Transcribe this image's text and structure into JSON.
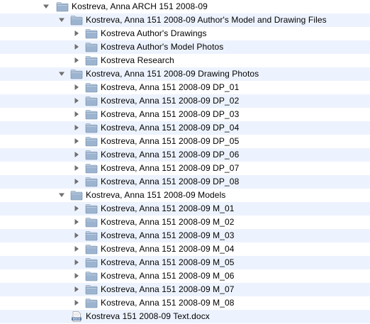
{
  "colors": {
    "row_alternate": "#edf3fe",
    "folder_body": "#9cb4cf",
    "folder_tab": "#b7c9dd",
    "disclosure": "#6f6f6f"
  },
  "tree": {
    "root": {
      "label": "Kostreva, Anna ARCH 151 2008-09",
      "icon": "folder-icon",
      "expanded": true
    },
    "authors_group": {
      "label": "Kostreva, Anna 151 2008-09 Author's Model and Drawing Files",
      "icon": "folder-icon",
      "expanded": true,
      "children": [
        {
          "label": "Kostreva Author's Drawings",
          "icon": "folder-icon",
          "expanded": false
        },
        {
          "label": "Kostreva Author's Model Photos",
          "icon": "folder-icon",
          "expanded": false
        },
        {
          "label": "Kostreva Research",
          "icon": "folder-icon",
          "expanded": false
        }
      ]
    },
    "drawing_photos_group": {
      "label": "Kostreva, Anna 151 2008-09 Drawing Photos",
      "icon": "folder-icon",
      "expanded": true,
      "children": [
        {
          "label": "Kostreva, Anna 151 2008-09 DP_01",
          "icon": "folder-icon",
          "expanded": false
        },
        {
          "label": "Kostreva, Anna 151 2008-09 DP_02",
          "icon": "folder-icon",
          "expanded": false
        },
        {
          "label": "Kostreva, Anna 151 2008-09 DP_03",
          "icon": "folder-icon",
          "expanded": false
        },
        {
          "label": "Kostreva, Anna 151 2008-09 DP_04",
          "icon": "folder-icon",
          "expanded": false
        },
        {
          "label": "Kostreva, Anna 151 2008-09 DP_05",
          "icon": "folder-icon",
          "expanded": false
        },
        {
          "label": "Kostreva, Anna 151 2008-09 DP_06",
          "icon": "folder-icon",
          "expanded": false
        },
        {
          "label": "Kostreva, Anna 151 2008-09 DP_07",
          "icon": "folder-icon",
          "expanded": false
        },
        {
          "label": "Kostreva, Anna 151 2008-09 DP_08",
          "icon": "folder-icon",
          "expanded": false
        }
      ]
    },
    "models_group": {
      "label": "Kostreva, Anna 151 2008-09 Models",
      "icon": "folder-icon",
      "expanded": true,
      "children": [
        {
          "label": "Kostreva, Anna 151 2008-09 M_01",
          "icon": "folder-icon",
          "expanded": false
        },
        {
          "label": "Kostreva, Anna 151 2008-09 M_02",
          "icon": "folder-icon",
          "expanded": false
        },
        {
          "label": "Kostreva, Anna 151 2008-09 M_03",
          "icon": "folder-icon",
          "expanded": false
        },
        {
          "label": "Kostreva, Anna 151 2008-09 M_04",
          "icon": "folder-icon",
          "expanded": false
        },
        {
          "label": "Kostreva, Anna 151 2008-09 M_05",
          "icon": "folder-icon",
          "expanded": false
        },
        {
          "label": "Kostreva, Anna 151 2008-09 M_06",
          "icon": "folder-icon",
          "expanded": false
        },
        {
          "label": "Kostreva, Anna 151 2008-09 M_07",
          "icon": "folder-icon",
          "expanded": false
        },
        {
          "label": "Kostreva, Anna 151 2008-09 M_08",
          "icon": "folder-icon",
          "expanded": false
        }
      ]
    },
    "document": {
      "label": "Kostreva 151 2008-09 Text.docx",
      "icon": "docx-file-icon",
      "icon_text": "DOCX"
    }
  }
}
